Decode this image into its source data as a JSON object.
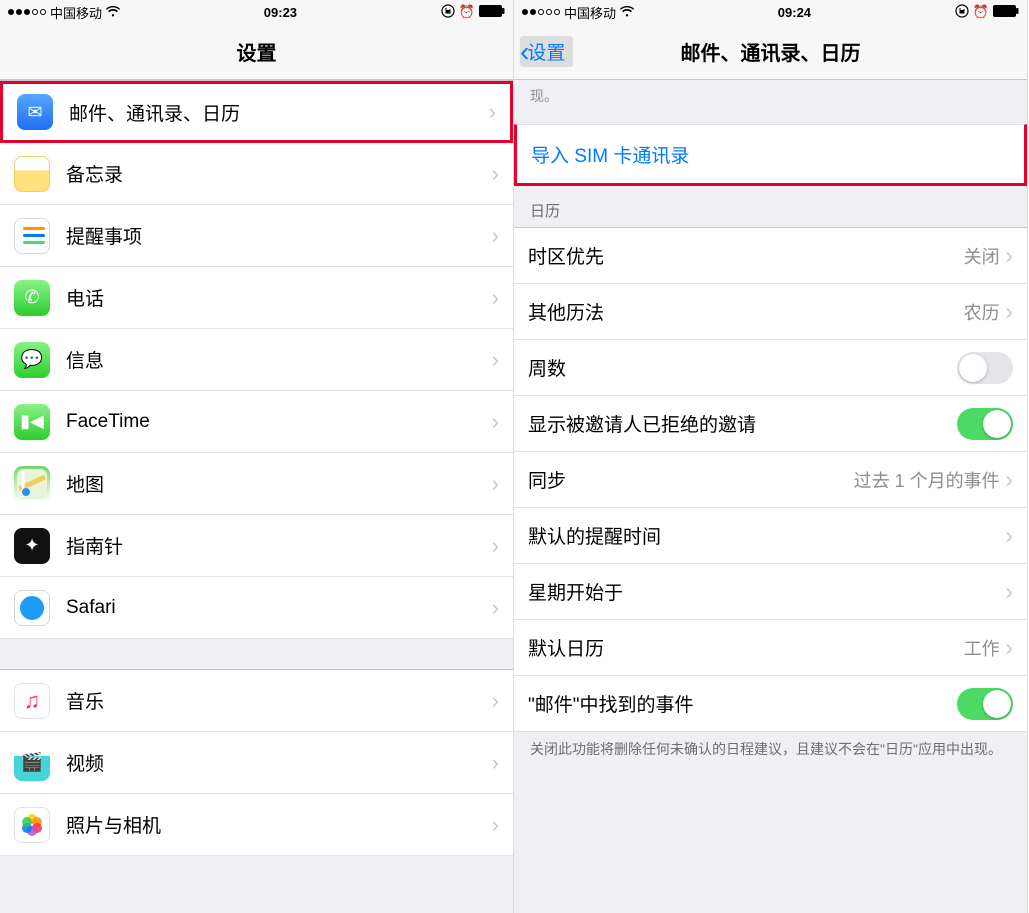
{
  "left": {
    "status": {
      "carrier": "中国移动",
      "time": "09:23"
    },
    "nav": {
      "title": "设置"
    },
    "rows": [
      {
        "label": "邮件、通讯录、日历",
        "iconClass": "icon-mail",
        "glyph": "✉",
        "highlight": true
      },
      {
        "label": "备忘录",
        "iconClass": "icon-notes",
        "glyph": ""
      },
      {
        "label": "提醒事项",
        "iconClass": "icon-reminders",
        "glyph": "stripes"
      },
      {
        "label": "电话",
        "iconClass": "icon-phone",
        "glyph": "✆"
      },
      {
        "label": "信息",
        "iconClass": "icon-messages",
        "glyph": "💬"
      },
      {
        "label": "FaceTime",
        "iconClass": "icon-facetime",
        "glyph": "▮◀"
      },
      {
        "label": "地图",
        "iconClass": "icon-maps",
        "glyph": ""
      },
      {
        "label": "指南针",
        "iconClass": "icon-compass",
        "glyph": "✦"
      },
      {
        "label": "Safari",
        "iconClass": "icon-safari",
        "glyph": "🧭"
      }
    ],
    "rows2": [
      {
        "label": "音乐",
        "iconClass": "icon-music",
        "glyph": "♫"
      },
      {
        "label": "视频",
        "iconClass": "icon-video",
        "glyph": "🎬"
      },
      {
        "label": "照片与相机",
        "iconClass": "icon-photos",
        "glyph": "❀"
      }
    ]
  },
  "right": {
    "status": {
      "carrier": "中国移动",
      "time": "09:24"
    },
    "nav": {
      "back": "设置",
      "title": "邮件、通讯录、日历"
    },
    "partialText": "现。",
    "actionCell": {
      "label": "导入 SIM 卡通讯录"
    },
    "sectionHeader": "日历",
    "rows": [
      {
        "label": "时区优先",
        "value": "关闭",
        "type": "value"
      },
      {
        "label": "其他历法",
        "value": "农历",
        "type": "value"
      },
      {
        "label": "周数",
        "type": "toggle",
        "on": false
      },
      {
        "label": "显示被邀请人已拒绝的邀请",
        "type": "toggle",
        "on": true
      },
      {
        "label": "同步",
        "value": "过去 1 个月的事件",
        "type": "value"
      },
      {
        "label": "默认的提醒时间",
        "type": "disclosure"
      },
      {
        "label": "星期开始于",
        "type": "disclosure"
      },
      {
        "label": "默认日历",
        "value": "工作",
        "type": "value"
      },
      {
        "label": "\"邮件\"中找到的事件",
        "type": "toggle",
        "on": true
      }
    ],
    "footer": "关闭此功能将删除任何未确认的日程建议，且建议不会在\"日历\"应用中出现。"
  }
}
